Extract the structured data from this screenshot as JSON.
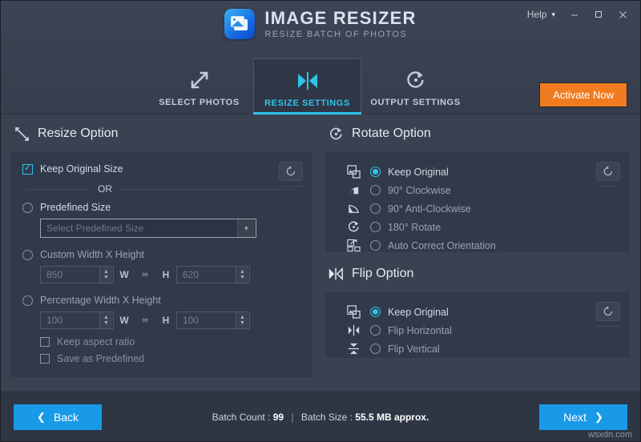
{
  "window": {
    "help_label": "Help",
    "minimize_icon": "minimize-icon",
    "maximize_icon": "maximize-icon",
    "close_icon": "close-icon"
  },
  "brand": {
    "title": "IMAGE RESIZER",
    "subtitle": "RESIZE BATCH OF PHOTOS",
    "logo_icon": "image-resizer-logo-icon"
  },
  "tabs": [
    {
      "label": "SELECT PHOTOS",
      "icon": "expand-arrows-icon",
      "active": false
    },
    {
      "label": "RESIZE SETTINGS",
      "icon": "resize-hourglass-icon",
      "active": true
    },
    {
      "label": "OUTPUT SETTINGS",
      "icon": "refresh-circle-icon",
      "active": false
    }
  ],
  "activate": {
    "label": "Activate Now"
  },
  "resize": {
    "title": "Resize Option",
    "title_icon": "resize-diagonal-icon",
    "reset_icon": "reset-icon",
    "keep_original_size": {
      "label": "Keep Original Size",
      "checked": true
    },
    "or_label": "OR",
    "predefined": {
      "label": "Predefined Size",
      "selected": false
    },
    "predefined_select": {
      "placeholder": "Select Predefined Size",
      "value": ""
    },
    "custom": {
      "label": "Custom Width X Height",
      "selected": false
    },
    "custom_values": {
      "width": "850",
      "height": "620",
      "w_label": "W",
      "h_label": "H",
      "link_icon": "link-icon"
    },
    "percentage": {
      "label": "Percentage Width X Height",
      "selected": false
    },
    "percentage_values": {
      "width": "100",
      "height": "100",
      "w_label": "W",
      "h_label": "H",
      "link_icon": "link-icon"
    },
    "keep_aspect_ratio": {
      "label": "Keep aspect ratio",
      "checked": false
    },
    "save_as_predefined": {
      "label": "Save as Predefined",
      "checked": false
    }
  },
  "rotate": {
    "title": "Rotate Option",
    "title_icon": "rotate-clockwise-icon",
    "reset_icon": "reset-icon",
    "options": [
      {
        "label": "Keep Original",
        "icon": "keep-original-icon",
        "selected": true
      },
      {
        "label": "90° Clockwise",
        "icon": "rotate-90-cw-icon",
        "selected": false
      },
      {
        "label": "90° Anti-Clockwise",
        "icon": "rotate-90-ccw-icon",
        "selected": false
      },
      {
        "label": "180° Rotate",
        "icon": "rotate-180-icon",
        "selected": false
      },
      {
        "label": "Auto Correct Orientation",
        "icon": "auto-correct-icon",
        "selected": false
      }
    ]
  },
  "flip": {
    "title": "Flip Option",
    "title_icon": "flip-icon",
    "reset_icon": "reset-icon",
    "options": [
      {
        "label": "Keep Original",
        "icon": "keep-original-icon",
        "selected": true
      },
      {
        "label": "Flip Horizontal",
        "icon": "flip-horizontal-icon",
        "selected": false
      },
      {
        "label": "Flip Vertical",
        "icon": "flip-vertical-icon",
        "selected": false
      }
    ]
  },
  "footer": {
    "back_label": "Back",
    "next_label": "Next",
    "batch_count_label": "Batch Count :",
    "batch_count_value": "99",
    "separator": "|",
    "batch_size_label": "Batch Size :",
    "batch_size_value": "55.5 MB approx.",
    "watermark": "wsxdn.com"
  },
  "colors": {
    "accent_cyan": "#2fc3e8",
    "accent_blue": "#189ae8",
    "accent_orange": "#f07c22",
    "body_bg": "#3a4252",
    "card_bg": "#313a4a"
  }
}
